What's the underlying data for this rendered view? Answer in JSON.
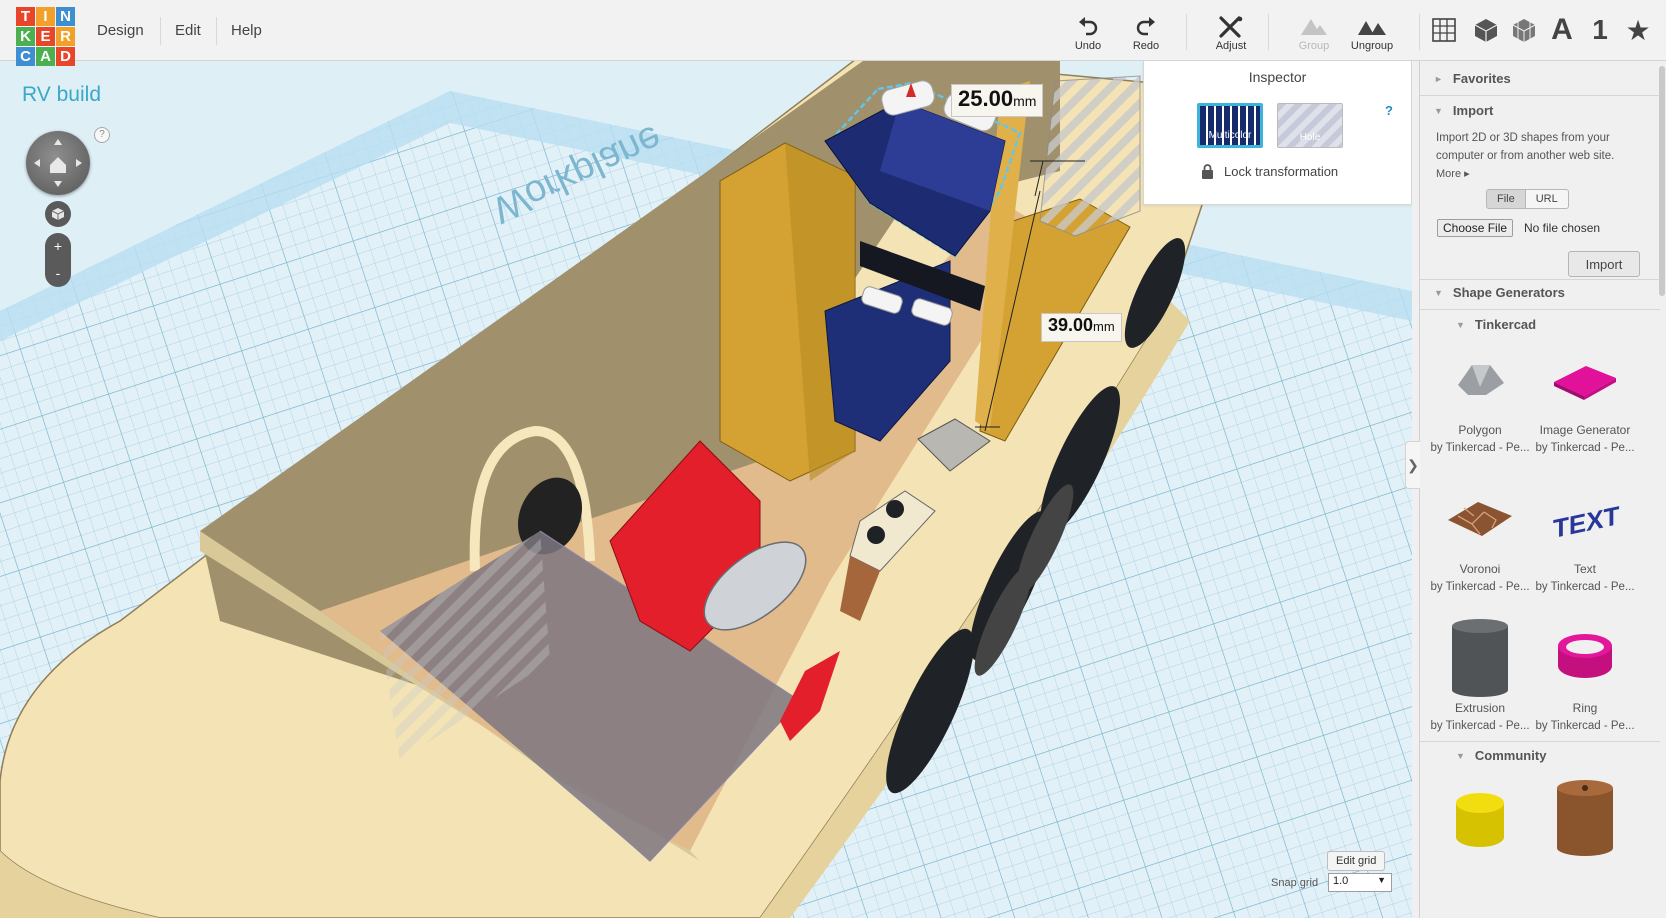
{
  "app": {
    "logo_letters": [
      "T",
      "I",
      "N",
      "K",
      "E",
      "R",
      "C",
      "A",
      "D"
    ],
    "logo_colors": [
      "#e8462b",
      "#f1a12a",
      "#3e8fd1",
      "#4caf50",
      "#e8462b",
      "#f1a12a",
      "#3e8fd1",
      "#4caf50",
      "#e8462b"
    ],
    "accent": "#3aa8c8"
  },
  "menus": [
    "Design",
    "Edit",
    "Help"
  ],
  "toolbar": {
    "undo": "Undo",
    "redo": "Redo",
    "adjust": "Adjust",
    "group": "Group",
    "ungroup": "Ungroup"
  },
  "view_icons": [
    "grid-view-icon",
    "cube-view-icon",
    "wireframe-view-icon",
    "text-A-icon",
    "number-1-icon",
    "star-icon"
  ],
  "text_icons": {
    "letter": "A",
    "number": "1",
    "star": "★"
  },
  "viewport": {
    "design_title": "RV build",
    "workplane_label": "Workplane",
    "nav_help": "?",
    "zoom_in": "+",
    "zoom_out": "-",
    "dimension_1": {
      "value": "25.00",
      "unit": "mm"
    },
    "dimension_2": {
      "value": "39.00",
      "unit": "mm"
    }
  },
  "inspector": {
    "title": "Inspector",
    "multicolor_label": "Multicolor",
    "hole_label": "Hole",
    "help": "?",
    "lock_label": "Lock transformation"
  },
  "grid": {
    "edit_grid": "Edit grid",
    "snap_label": "Snap grid",
    "snap_value": "1.0"
  },
  "panel": {
    "favorites": "Favorites",
    "import": {
      "title": "Import",
      "description": "Import 2D or 3D shapes from your computer or from another web site.",
      "more": "More",
      "tab_file": "File",
      "tab_url": "URL",
      "choose_file": "Choose File",
      "no_file": "No file chosen",
      "button": "Import"
    },
    "shape_generators": "Shape Generators",
    "tinkercad_section": "Tinkercad",
    "community_section": "Community",
    "shapes": [
      {
        "name": "Polygon",
        "by": "by Tinkercad - Pe..."
      },
      {
        "name": "Image Generator",
        "by": "by Tinkercad - Pe..."
      },
      {
        "name": "Voronoi",
        "by": "by Tinkercad - Pe..."
      },
      {
        "name": "Text",
        "by": "by Tinkercad - Pe..."
      },
      {
        "name": "Extrusion",
        "by": "by Tinkercad - Pe..."
      },
      {
        "name": "Ring",
        "by": "by Tinkercad - Pe..."
      }
    ]
  }
}
